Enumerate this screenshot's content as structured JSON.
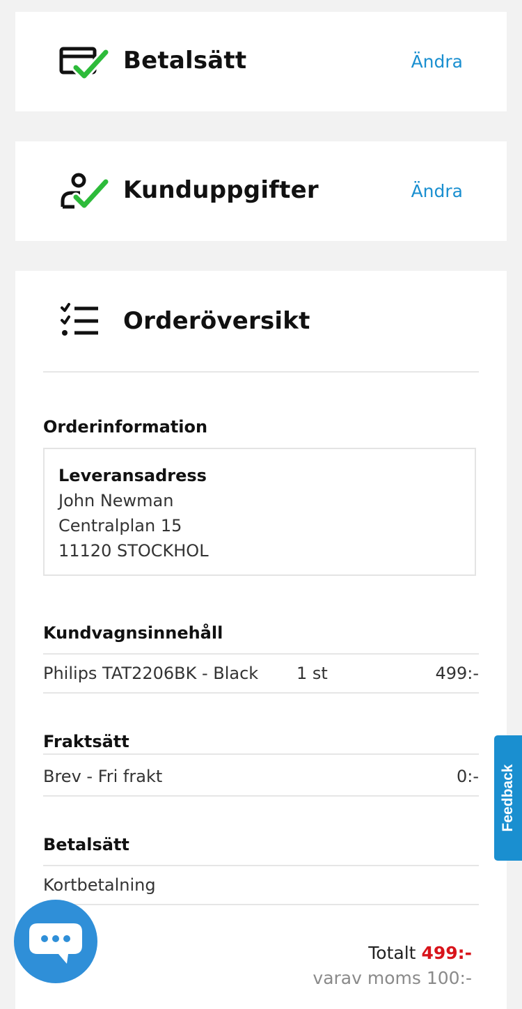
{
  "payment_card": {
    "title": "Betalsätt",
    "change": "Ändra",
    "icon": "card-check-icon"
  },
  "customer_card": {
    "title": "Kunduppgifter",
    "change": "Ändra",
    "icon": "person-check-icon"
  },
  "order_card": {
    "title": "Orderöversikt",
    "icon": "checklist-icon",
    "order_info": {
      "heading": "Orderinformation",
      "address_label": "Leveransadress",
      "name": "John Newman",
      "street": "Centralplan 15",
      "postal": "11120 STOCKHOL"
    },
    "cart": {
      "heading": "Kundvagnsinnehåll",
      "items": [
        {
          "name": "Philips TAT2206BK - Black",
          "qty": "1 st",
          "price": "499:-"
        }
      ]
    },
    "shipping": {
      "heading": "Fraktsätt",
      "method": "Brev - Fri frakt",
      "price": "0:-"
    },
    "payment": {
      "heading": "Betalsätt",
      "method": "Kortbetalning"
    },
    "totals": {
      "label": "Totalt",
      "value": "499:-",
      "vat_text": "varav moms 100:-"
    }
  },
  "feedback_tab": {
    "label": "Feedback"
  },
  "chat_button": {
    "icon": "chat-bubble-icon"
  },
  "colors": {
    "accent": "#1a8fd0",
    "check_green": "#2dbb3a",
    "total_red": "#d8141b",
    "chat_blue": "#2f8fd8"
  }
}
